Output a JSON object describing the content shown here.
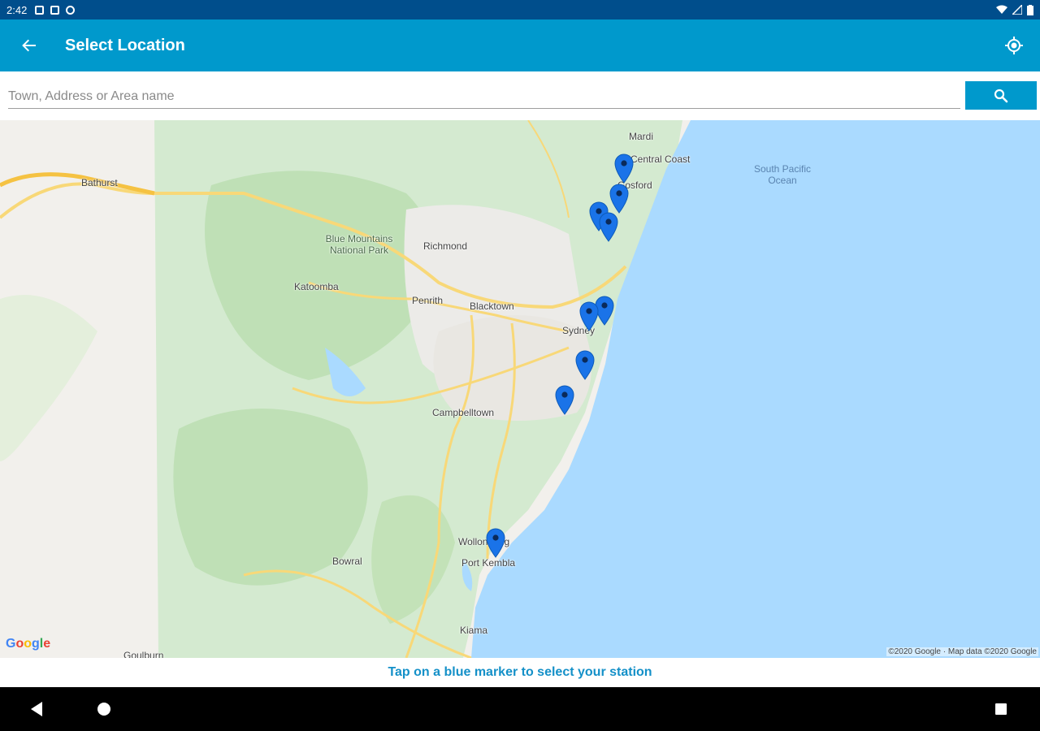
{
  "status_bar": {
    "time": "2:42",
    "icons": [
      "notification-icon",
      "sd-card-icon",
      "sync-disabled-icon"
    ],
    "right_icons": [
      "wifi-icon",
      "signal-icon",
      "battery-icon"
    ]
  },
  "app_bar": {
    "title": "Select Location",
    "back_icon": "arrow-back-icon",
    "locate_icon": "my-location-icon"
  },
  "search": {
    "placeholder": "Town, Address or Area name",
    "value": "",
    "button_icon": "search-icon"
  },
  "map": {
    "labels": {
      "bathurst": "Bathurst",
      "mardi": "Mardi",
      "central_coast": "Central Coast",
      "gosford": "Gosford",
      "south_pacific_ocean": "South Pacific Ocean",
      "blue_mountains": "Blue Mountains National Park",
      "richmond": "Richmond",
      "katoomba": "Katoomba",
      "penrith": "Penrith",
      "blacktown": "Blacktown",
      "sydney": "Sydney",
      "campbelltown": "Campbelltown",
      "wollongong": "Wollongong",
      "port_kembla": "Port Kembla",
      "bowral": "Bowral",
      "kiama": "Kiama",
      "goulburn": "Goulburn"
    },
    "marker_count": 10,
    "marker_color": "#1a73e8",
    "attribution": "©2020 Google · Map data ©2020 Google",
    "logo": "Google"
  },
  "hint": {
    "text": "Tap on a blue marker to select your station"
  },
  "nav_bar": {
    "icons": [
      "nav-back-icon",
      "nav-home-icon",
      "nav-recents-icon"
    ]
  },
  "colors": {
    "status_bar": "#004e8c",
    "app_bar": "#0099cc",
    "accent_text": "#1490c8",
    "ocean": "#aadaff",
    "land_green": "#c8e6c0"
  }
}
